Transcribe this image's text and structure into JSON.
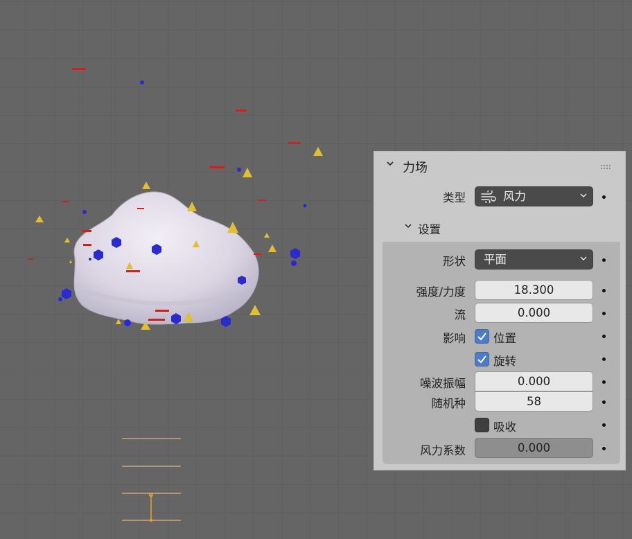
{
  "panel": {
    "title": "力场",
    "type_label": "类型",
    "type_value": "风力",
    "settings_title": "设置",
    "shape_label": "形状",
    "shape_value": "平面",
    "strength_label": "强度/力度",
    "strength_value": "18.300",
    "flow_label": "流",
    "flow_value": "0.000",
    "affect_label": "影响",
    "affect_location_label": "位置",
    "affect_location_checked": true,
    "affect_rotation_label": "旋转",
    "affect_rotation_checked": true,
    "noise_label": "噪波振幅",
    "noise_value": "0.000",
    "seed_label": "随机种",
    "seed_value": "58",
    "absorption_label": "吸收",
    "absorption_checked": false,
    "wind_factor_label": "风力系数",
    "wind_factor_value": "0.000"
  },
  "icons": {
    "type_icon": "wind-icon",
    "collapse_icon": "chevron-down-icon",
    "drag_icon": "grip-dots-icon"
  },
  "colors": {
    "viewport_bg": "#656565",
    "panel_bg": "#c9c9c9",
    "checkbox_on": "#4f7bc4",
    "mesh": "#ddd8e6",
    "particle_red": "#d02020",
    "particle_blue": "#2a2ad0",
    "particle_yellow": "#e0c030"
  }
}
